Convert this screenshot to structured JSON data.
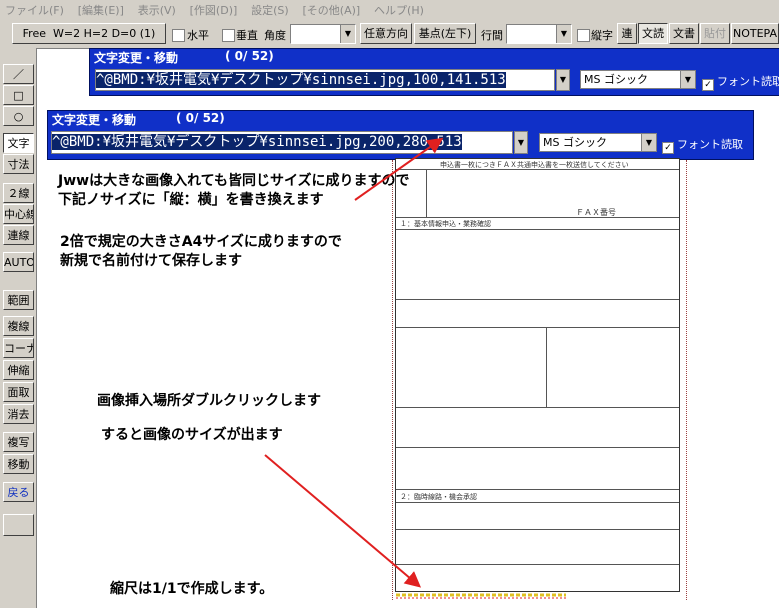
{
  "menu": [
    "ファイル(F)",
    "[編集(E)]",
    "表示(V)",
    "[作図(D)]",
    "設定(S)",
    "[その他(A)]",
    "ヘルプ(H)"
  ],
  "toolbar": {
    "free_label": "Free",
    "wh_label": "W=2 H=2 D=0 (1)",
    "horizontal": "水平",
    "vertical": "垂直",
    "angle": "角度",
    "any_direction": "任意方向",
    "base_point": "基点(左下)",
    "line_spacing": "行間",
    "vertical_text": "縦字",
    "ren": "連",
    "bunyomi": "文読",
    "bunsho": "文書",
    "paste": "貼付",
    "notepad": "NOTEPA"
  },
  "leftbar": [
    {
      "label": "／"
    },
    {
      "label": "□"
    },
    {
      "label": "○"
    },
    {
      "label": "文字",
      "selected": true
    },
    {
      "label": "寸法"
    },
    {
      "label": "２線"
    },
    {
      "label": "中心線"
    },
    {
      "label": "連線"
    },
    {
      "label": "AUTO"
    },
    {
      "label": "範囲"
    },
    {
      "label": "複線"
    },
    {
      "label": "コーナー"
    },
    {
      "label": "伸縮"
    },
    {
      "label": "面取"
    },
    {
      "label": "消去"
    },
    {
      "label": "複写"
    },
    {
      "label": "移動"
    },
    {
      "label": "戻る",
      "blue": true
    }
  ],
  "dialog1": {
    "title": "文字変更・移動",
    "counter": "( 0/ 52)",
    "path": "^@BMD:¥坂井電気¥デスクトップ¥sinnsei.jpg,100,141.513",
    "font": "MS ゴシック",
    "font_read": "フォント読取"
  },
  "dialog2": {
    "title": "文字変更・移動",
    "counter": "( 0/ 52)",
    "path": "^@BMD:¥坂井電気¥デスクトップ¥sinnsei.jpg,200,280.513",
    "font": "MS ゴシック",
    "font_read": "フォント読取"
  },
  "notes": {
    "n1": "Jwwは大きな画像入れても皆同じサイズに成りますので",
    "n2": "下記ノサイズに「縦：横」を書き換えます",
    "n3": "2倍で規定の大きさA4サイズに成りますので",
    "n4": "新規で名前付けて保存します",
    "n5": "画像挿入場所ダブルクリックします",
    "n6": "すると画像のサイズが出ます",
    "n7": "縮尺は1/1で作成します。"
  },
  "form": {
    "header": "申込書一枚につきＦＡＸ共通申込書を一枚送信してください",
    "fax_label": "ＦＡＸ番号",
    "sec1": "１：基本情報申込・業務確認",
    "sec2": "２：臨時線路・機会承認"
  },
  "colors": {
    "accent": "#1030c8",
    "arrow": "#e02020",
    "ui_gray": "#d4d0c8"
  }
}
